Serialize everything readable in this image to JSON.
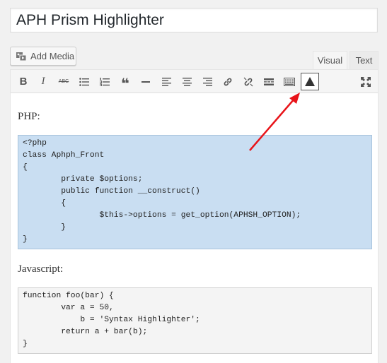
{
  "post": {
    "title": "APH Prism Highlighter"
  },
  "media": {
    "add_media_label": "Add Media"
  },
  "editor_tabs": {
    "visual": "Visual",
    "text": "Text"
  },
  "toolbar": {
    "buttons": [
      "bold-icon",
      "italic-icon",
      "strikethrough-icon",
      "bulleted-list-icon",
      "numbered-list-icon",
      "blockquote-icon",
      "horizontal-line-icon",
      "align-left-icon",
      "align-center-icon",
      "align-right-icon",
      "insert-link-icon",
      "remove-link-icon",
      "read-more-icon",
      "toolbar-toggle-icon",
      "prism-highlighter-icon",
      "fullscreen-icon"
    ],
    "bold": "B",
    "italic": "I",
    "strikethrough": "ABC",
    "blockquote": "❝"
  },
  "content": {
    "php_heading": "PHP:",
    "php_code": "<?php\nclass Aphph_Front\n{\n        private $options;\n        public function __construct()\n        {\n                $this->options = get_option(APHSH_OPTION);\n        }\n}",
    "js_heading": "Javascript:",
    "js_code": "function foo(bar) {\n        var a = 50,\n            b = 'Syntax Highlighter';\n        return a + bar(b);\n}"
  },
  "annotation": {
    "arrow_color": "#e8141a"
  }
}
